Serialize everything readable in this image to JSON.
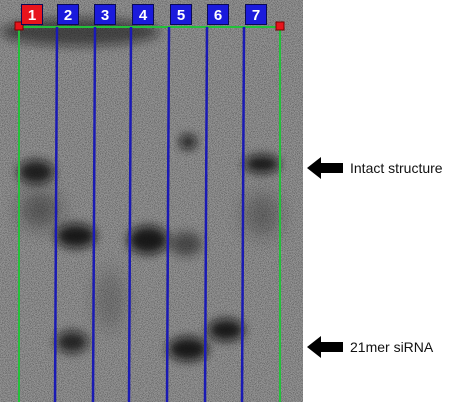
{
  "lanes": [
    {
      "label": "1",
      "color": "#e8141c"
    },
    {
      "label": "2",
      "color": "#1a1adc"
    },
    {
      "label": "3",
      "color": "#1a1adc"
    },
    {
      "label": "4",
      "color": "#1a1adc"
    },
    {
      "label": "5",
      "color": "#1a1adc"
    },
    {
      "label": "6",
      "color": "#1a1adc"
    },
    {
      "label": "7",
      "color": "#1a1adc"
    }
  ],
  "annotations": [
    {
      "label": "Intact structure",
      "icon": "left-arrow-icon"
    },
    {
      "label": "21mer siRNA",
      "icon": "left-arrow-icon"
    }
  ],
  "colors": {
    "lane_divider": "#1a1ab4",
    "frame": "#22c13a",
    "marker": "#e8141c",
    "band": "#111111"
  }
}
